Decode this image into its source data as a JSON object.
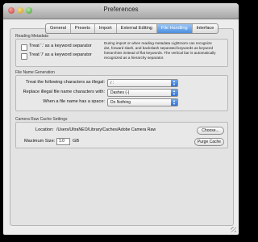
{
  "window": {
    "title": "Preferences"
  },
  "tabs": [
    {
      "label": "General"
    },
    {
      "label": "Presets"
    },
    {
      "label": "Import"
    },
    {
      "label": "External Editing"
    },
    {
      "label": "File Handling",
      "active": true
    },
    {
      "label": "Interface"
    }
  ],
  "reading_metadata": {
    "section_label": "Reading Metadata",
    "option_dot": "Treat '.' as a keyword separator",
    "option_slash": "Treat '/' as a keyword separator",
    "note_lines": [
      "During import or when reading metadata Lightroom can recognize",
      "dot, forward slash, and backslash separated keywords as keyword",
      "hierarchies instead of flat keywords. The vertical bar is automatically",
      "recognized as a hierarchy separator."
    ]
  },
  "file_name_generation": {
    "section_label": "File Name Generation",
    "illegal_label": "Treat the following characters as illegal:",
    "illegal_value": "/ :",
    "replace_label": "Replace illegal file name characters with:",
    "replace_value": "Dashes (-)",
    "space_label": "When a file name has a space:",
    "space_value": "Do Nothing"
  },
  "camera_raw_cache": {
    "section_label": "Camera Raw Cache Settings",
    "location_label": "Location:",
    "location_value": "/Users/UltraNEO/Library/Caches/Adobe Camera Raw",
    "choose_label": "Choose...",
    "max_size_label": "Maximum Size:",
    "max_size_value": "1.0",
    "max_size_unit": "GB",
    "purge_label": "Purge Cache"
  },
  "colors": {
    "selected_tab": "#4a8fe0",
    "popup_arrow": "#2f6fd1"
  }
}
